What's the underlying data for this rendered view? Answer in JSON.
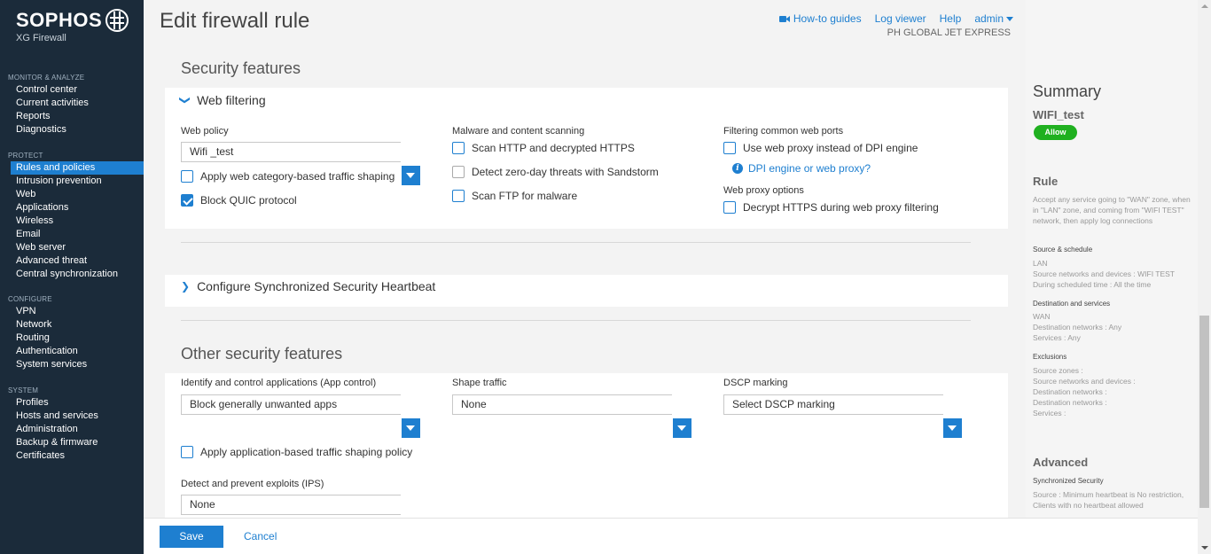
{
  "brand": {
    "name": "SOPHOS",
    "product": "XG Firewall"
  },
  "nav": {
    "monitor": {
      "heading": "MONITOR & ANALYZE",
      "items": [
        "Control center",
        "Current activities",
        "Reports",
        "Diagnostics"
      ]
    },
    "protect": {
      "heading": "PROTECT",
      "items": [
        "Rules and policies",
        "Intrusion prevention",
        "Web",
        "Applications",
        "Wireless",
        "Email",
        "Web server",
        "Advanced threat",
        "Central synchronization"
      ]
    },
    "configure": {
      "heading": "CONFIGURE",
      "items": [
        "VPN",
        "Network",
        "Routing",
        "Authentication",
        "System services"
      ]
    },
    "system": {
      "heading": "SYSTEM",
      "items": [
        "Profiles",
        "Hosts and services",
        "Administration",
        "Backup & firmware",
        "Certificates"
      ]
    }
  },
  "header": {
    "title": "Edit firewall rule",
    "links": {
      "howto": "How-to guides",
      "log": "Log viewer",
      "help": "Help",
      "user": "admin"
    },
    "company": "PH GLOBAL JET EXPRESS"
  },
  "security": {
    "title": "Security features",
    "web_filtering": {
      "label": "Web filtering",
      "web_policy_label": "Web policy",
      "web_policy_value": "Wifi _test",
      "apply_shaping": "Apply web category-based traffic shaping",
      "block_quic": "Block QUIC protocol",
      "malware_label": "Malware and content scanning",
      "scan_http": "Scan HTTP and decrypted HTTPS",
      "zero_day": "Detect zero-day threats with Sandstorm",
      "scan_ftp": "Scan FTP for malware",
      "ports_label": "Filtering common web ports",
      "use_proxy": "Use web proxy instead of DPI engine",
      "dpi_link": "DPI engine or web proxy?",
      "proxy_opts_label": "Web proxy options",
      "decrypt_https": "Decrypt HTTPS during web proxy filtering"
    },
    "heartbeat": {
      "label": "Configure Synchronized Security Heartbeat"
    }
  },
  "other": {
    "title": "Other security features",
    "app_control_label": "Identify and control applications (App control)",
    "app_control_value": "Block generally unwanted apps",
    "shape_label": "Shape traffic",
    "shape_value": "None",
    "dscp_label": "DSCP marking",
    "dscp_value": "Select DSCP marking",
    "app_shaping": "Apply application-based traffic shaping policy",
    "ips_label": "Detect and prevent exploits (IPS)",
    "ips_value": "None"
  },
  "footer": {
    "save": "Save",
    "cancel": "Cancel"
  },
  "summary": {
    "title": "Summary",
    "rule_name": "WIFI_test",
    "action": "Allow",
    "rule_heading": "Rule",
    "rule_desc": "Accept any service going to \"WAN\" zone, when in \"LAN\" zone, and coming from \"WIFI TEST\" network, then apply log connections",
    "source_heading": "Source & schedule",
    "source_zone": "LAN",
    "source_networks": "Source networks and devices : WIFI TEST",
    "schedule": "During scheduled time : All the time",
    "dest_heading": "Destination and services",
    "dest_zone": "WAN",
    "dest_networks": "Destination networks : Any",
    "services": "Services : Any",
    "excl_heading": "Exclusions",
    "excl_source_zones": "Source zones :",
    "excl_source_networks": "Source networks and devices :",
    "excl_dest_networks_1": "Destination networks :",
    "excl_dest_networks_2": "Destination networks :",
    "excl_services": "Services :",
    "advanced_heading": "Advanced",
    "sync_heading": "Synchronized Security",
    "sync_text": "Source : Minimum heartbeat is No restriction, Clients with no heartbeat allowed"
  },
  "colors": {
    "sidebar": "#1b2b3a",
    "accent": "#1e7fd0",
    "allow": "#20b020"
  }
}
